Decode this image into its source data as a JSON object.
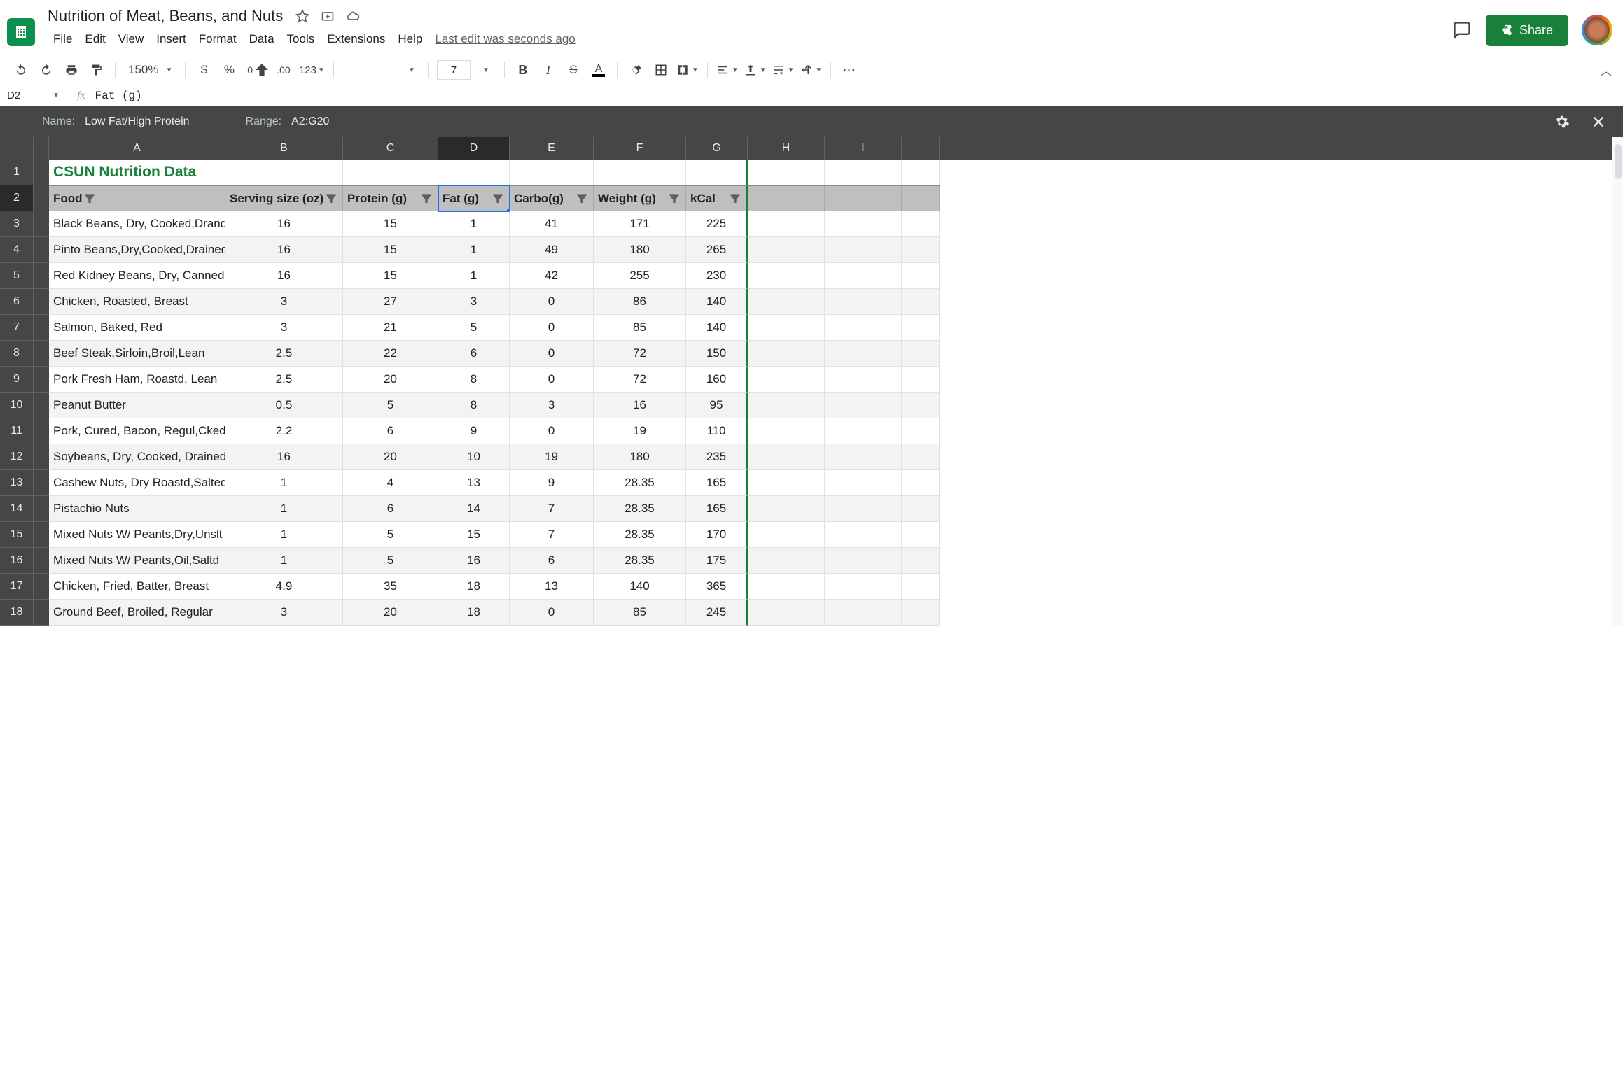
{
  "doc": {
    "title": "Nutrition of Meat, Beans, and Nuts",
    "last_edit": "Last edit was seconds ago"
  },
  "menu": {
    "file": "File",
    "edit": "Edit",
    "view": "View",
    "insert": "Insert",
    "format": "Format",
    "data": "Data",
    "tools": "Tools",
    "extensions": "Extensions",
    "help": "Help"
  },
  "header": {
    "share": "Share"
  },
  "toolbar": {
    "zoom": "150%",
    "font_size": "7",
    "currency": "$",
    "percent": "%",
    "dec_dec": ".0",
    "inc_dec": ".00",
    "num_fmt": "123"
  },
  "formula": {
    "name_box": "D2",
    "fx": "fx",
    "value": "Fat (g)"
  },
  "filter": {
    "name_label": "Name:",
    "name_value": "Low Fat/High Protein",
    "range_label": "Range:",
    "range_value": "A2:G20"
  },
  "columns": [
    "A",
    "B",
    "C",
    "D",
    "E",
    "F",
    "G",
    "H",
    "I"
  ],
  "sheet_title": "CSUN Nutrition Data",
  "headers": {
    "food": "Food",
    "serving": "Serving size (oz)",
    "protein": "Protein (g)",
    "fat": "Fat (g)",
    "carbo": "Carbo(g)",
    "weight": "Weight (g)",
    "kcal": "kCal"
  },
  "rows": [
    {
      "n": "3",
      "food": "Black Beans, Dry, Cooked,Drand",
      "serving": "16",
      "protein": "15",
      "fat": "1",
      "carbo": "41",
      "weight": "171",
      "kcal": "225"
    },
    {
      "n": "4",
      "food": "Pinto Beans,Dry,Cooked,Drained",
      "serving": "16",
      "protein": "15",
      "fat": "1",
      "carbo": "49",
      "weight": "180",
      "kcal": "265",
      "zebra": true
    },
    {
      "n": "5",
      "food": "Red Kidney Beans, Dry, Canned",
      "serving": "16",
      "protein": "15",
      "fat": "1",
      "carbo": "42",
      "weight": "255",
      "kcal": "230"
    },
    {
      "n": "6",
      "food": "Chicken, Roasted, Breast",
      "serving": "3",
      "protein": "27",
      "fat": "3",
      "carbo": "0",
      "weight": "86",
      "kcal": "140",
      "zebra": true
    },
    {
      "n": "7",
      "food": "Salmon, Baked, Red",
      "serving": "3",
      "protein": "21",
      "fat": "5",
      "carbo": "0",
      "weight": "85",
      "kcal": "140"
    },
    {
      "n": "8",
      "food": "Beef Steak,Sirloin,Broil,Lean",
      "serving": "2.5",
      "protein": "22",
      "fat": "6",
      "carbo": "0",
      "weight": "72",
      "kcal": "150",
      "zebra": true
    },
    {
      "n": "9",
      "food": "Pork Fresh Ham, Roastd, Lean",
      "serving": "2.5",
      "protein": "20",
      "fat": "8",
      "carbo": "0",
      "weight": "72",
      "kcal": "160"
    },
    {
      "n": "10",
      "food": "Peanut Butter",
      "serving": "0.5",
      "protein": "5",
      "fat": "8",
      "carbo": "3",
      "weight": "16",
      "kcal": "95",
      "zebra": true
    },
    {
      "n": "11",
      "food": "Pork, Cured, Bacon, Regul,Cked",
      "serving": "2.2",
      "protein": "6",
      "fat": "9",
      "carbo": "0",
      "weight": "19",
      "kcal": "110"
    },
    {
      "n": "12",
      "food": "Soybeans, Dry, Cooked, Drained",
      "serving": "16",
      "protein": "20",
      "fat": "10",
      "carbo": "19",
      "weight": "180",
      "kcal": "235",
      "zebra": true
    },
    {
      "n": "13",
      "food": "Cashew Nuts, Dry Roastd,Salted",
      "serving": "1",
      "protein": "4",
      "fat": "13",
      "carbo": "9",
      "weight": "28.35",
      "kcal": "165"
    },
    {
      "n": "14",
      "food": "Pistachio Nuts",
      "serving": "1",
      "protein": "6",
      "fat": "14",
      "carbo": "7",
      "weight": "28.35",
      "kcal": "165",
      "zebra": true
    },
    {
      "n": "15",
      "food": "Mixed Nuts W/ Peants,Dry,Unslt",
      "serving": "1",
      "protein": "5",
      "fat": "15",
      "carbo": "7",
      "weight": "28.35",
      "kcal": "170"
    },
    {
      "n": "16",
      "food": "Mixed Nuts W/ Peants,Oil,Saltd",
      "serving": "1",
      "protein": "5",
      "fat": "16",
      "carbo": "6",
      "weight": "28.35",
      "kcal": "175",
      "zebra": true
    },
    {
      "n": "17",
      "food": "Chicken, Fried, Batter, Breast",
      "serving": "4.9",
      "protein": "35",
      "fat": "18",
      "carbo": "13",
      "weight": "140",
      "kcal": "365"
    },
    {
      "n": "18",
      "food": "Ground Beef, Broiled, Regular",
      "serving": "3",
      "protein": "20",
      "fat": "18",
      "carbo": "0",
      "weight": "85",
      "kcal": "245",
      "zebra": true
    }
  ],
  "chart_data": {
    "type": "table",
    "title": "CSUN Nutrition Data",
    "columns": [
      "Food",
      "Serving size (oz)",
      "Protein (g)",
      "Fat (g)",
      "Carbo(g)",
      "Weight (g)",
      "kCal"
    ],
    "rows": [
      [
        "Black Beans, Dry, Cooked,Drand",
        16,
        15,
        1,
        41,
        171,
        225
      ],
      [
        "Pinto Beans,Dry,Cooked,Drained",
        16,
        15,
        1,
        49,
        180,
        265
      ],
      [
        "Red Kidney Beans, Dry, Canned",
        16,
        15,
        1,
        42,
        255,
        230
      ],
      [
        "Chicken, Roasted, Breast",
        3,
        27,
        3,
        0,
        86,
        140
      ],
      [
        "Salmon, Baked, Red",
        3,
        21,
        5,
        0,
        85,
        140
      ],
      [
        "Beef Steak,Sirloin,Broil,Lean",
        2.5,
        22,
        6,
        0,
        72,
        150
      ],
      [
        "Pork Fresh Ham, Roastd, Lean",
        2.5,
        20,
        8,
        0,
        72,
        160
      ],
      [
        "Peanut Butter",
        0.5,
        5,
        8,
        3,
        16,
        95
      ],
      [
        "Pork, Cured, Bacon, Regul,Cked",
        2.2,
        6,
        9,
        0,
        19,
        110
      ],
      [
        "Soybeans, Dry, Cooked, Drained",
        16,
        20,
        10,
        19,
        180,
        235
      ],
      [
        "Cashew Nuts, Dry Roastd,Salted",
        1,
        4,
        13,
        9,
        28.35,
        165
      ],
      [
        "Pistachio Nuts",
        1,
        6,
        14,
        7,
        28.35,
        165
      ],
      [
        "Mixed Nuts W/ Peants,Dry,Unslt",
        1,
        5,
        15,
        7,
        28.35,
        170
      ],
      [
        "Mixed Nuts W/ Peants,Oil,Saltd",
        1,
        5,
        16,
        6,
        28.35,
        175
      ],
      [
        "Chicken, Fried, Batter, Breast",
        4.9,
        35,
        18,
        13,
        140,
        365
      ],
      [
        "Ground Beef, Broiled, Regular",
        3,
        20,
        18,
        0,
        85,
        245
      ]
    ]
  }
}
